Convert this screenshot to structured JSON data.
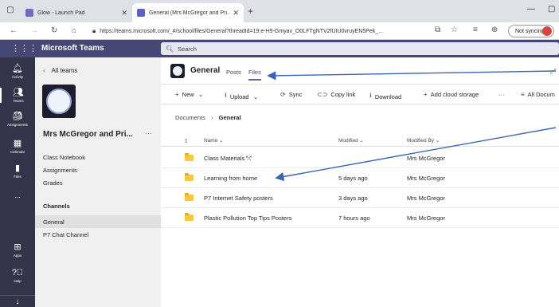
{
  "browser": {
    "tabs": [
      {
        "title": "Glow - Launch Pad"
      },
      {
        "title": "General (Mrs McGregor and Pri..."
      }
    ],
    "url": "https://teams.microsoft.com/_#/school/files/General?threadId=19:e-H9-Gmyav_O0LFTgNTV2fUIU0vruyEN5Pek_...",
    "sync_label": "Not syncing"
  },
  "teams": {
    "app_title": "Microsoft Teams",
    "search_placeholder": "Search"
  },
  "rail": [
    {
      "label": "Activity",
      "icon": "bell-icon"
    },
    {
      "label": "Teams",
      "icon": "teams-icon"
    },
    {
      "label": "Assignments",
      "icon": "assignments-icon"
    },
    {
      "label": "Calendar",
      "icon": "calendar-icon"
    },
    {
      "label": "Files",
      "icon": "files-icon"
    },
    {
      "label": "...",
      "icon": "more-icon"
    },
    {
      "label": "Apps",
      "icon": "apps-icon"
    },
    {
      "label": "Help",
      "icon": "help-icon"
    }
  ],
  "sidebar": {
    "back_label": "All teams",
    "team_name": "Mrs McGregor and Pri...",
    "links": [
      "Class Notebook",
      "Assignments",
      "Grades"
    ],
    "channels_heading": "Channels",
    "channels": [
      "General",
      "P7 Chat Channel"
    ]
  },
  "channel": {
    "title": "General",
    "tabs": [
      "Posts",
      "Files"
    ]
  },
  "commands": {
    "new": "New",
    "upload": "Upload",
    "sync": "Sync",
    "copy_link": "Copy link",
    "download": "Download",
    "add_storage": "Add cloud storage",
    "more": "···",
    "all_docs": "All Docum"
  },
  "breadcrumb": {
    "root": "Documents",
    "current": "General"
  },
  "files": {
    "columns": [
      "Name",
      "Modified",
      "Modified By"
    ],
    "rows": [
      {
        "name": "Class Materials",
        "modified": "",
        "modified_by": "Mrs McGregor"
      },
      {
        "name": "Learning from home",
        "modified": "5 days ago",
        "modified_by": "Mrs McGregor"
      },
      {
        "name": "P7 Internet Safety posters",
        "modified": "3 days ago",
        "modified_by": "Mrs McGregor"
      },
      {
        "name": "Plastic Pollution Top Tips Posters",
        "modified": "7 hours ago",
        "modified_by": "Mrs McGregor"
      }
    ]
  },
  "colors": {
    "teams_purple": "#464775",
    "rail": "#33344a",
    "accent": "#6264a7",
    "annotation_arrow": "#3a64b4"
  }
}
